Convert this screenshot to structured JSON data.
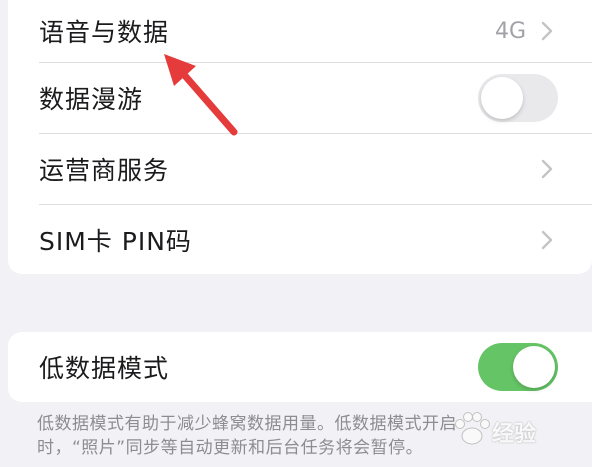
{
  "settings_group": {
    "rows": [
      {
        "label": "语音与数据",
        "value": "4G"
      },
      {
        "label": "数据漫游"
      },
      {
        "label": "运营商服务"
      },
      {
        "label": "SIM卡 PIN码"
      }
    ],
    "data_roaming": {
      "state": "off"
    }
  },
  "low_data_group": {
    "label": "低数据模式",
    "toggle": {
      "state": "on",
      "color": "#65c466"
    },
    "footnote_lines": [
      "低数据模式有助于减少蜂窝数据用量。低数据模式开启",
      "时，“照片”同步等自动更新和后台任务将会暂停。"
    ]
  },
  "annotation": {
    "color": "#e63b3b"
  },
  "watermark": {
    "text": "经验"
  },
  "colors": {
    "background": "#f2f2f6",
    "card": "#ffffff",
    "label": "#1b1b1d",
    "secondary": "#a2a2a7",
    "chevron": "#c4c4c7"
  }
}
